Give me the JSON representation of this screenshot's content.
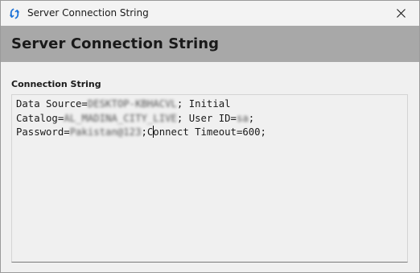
{
  "window": {
    "title": "Server Connection String",
    "app_icon": "sync-arrows-icon",
    "close_icon": "close-icon"
  },
  "header": {
    "title": "Server Connection String"
  },
  "field": {
    "label": "Connection String"
  },
  "connection_string": {
    "data_source_key": "Data Source=",
    "data_source_value": "DESKTOP-KBHACVL",
    "initial_text": "; Initial",
    "catalog_key": "Catalog=",
    "catalog_value": "AL_MADINA_CITY_LIVE",
    "user_id_text": "; User ID=",
    "user_id_value": "sa",
    "line2_end": ";",
    "password_key": "Password=",
    "password_value": "Pakistan@123",
    "semicolon": ";",
    "connect_c": "C",
    "connect_rest": "onnect Timeout=600;"
  },
  "colors": {
    "accent": "#1e73d8",
    "header_band": "#a8a8a8",
    "window_bg": "#f0f0f0"
  }
}
